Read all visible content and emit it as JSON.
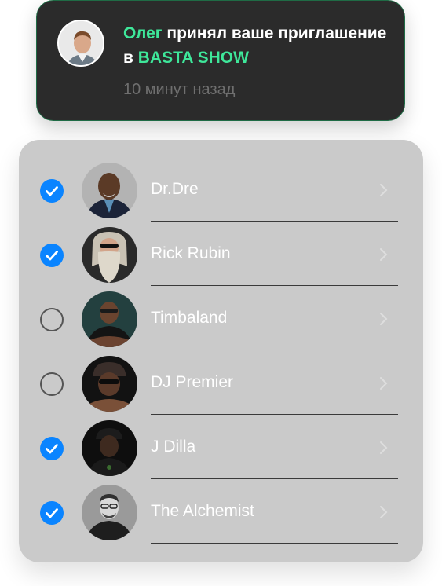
{
  "notification": {
    "sender": "Олег",
    "message": " принял ваше приглашение в ",
    "event": "BASTA SHOW",
    "time": "10 минут назад"
  },
  "colors": {
    "accent": "#3ee79a",
    "check": "#0a84ff",
    "card_bg": "#2b2b2b",
    "panel_bg": "#cacaca"
  },
  "contacts": [
    {
      "name": "Dr.Dre",
      "checked": true
    },
    {
      "name": "Rick Rubin",
      "checked": true
    },
    {
      "name": "Timbaland",
      "checked": false
    },
    {
      "name": "DJ Premier",
      "checked": false
    },
    {
      "name": "J Dilla",
      "checked": true
    },
    {
      "name": "The Alchemist",
      "checked": true
    }
  ]
}
